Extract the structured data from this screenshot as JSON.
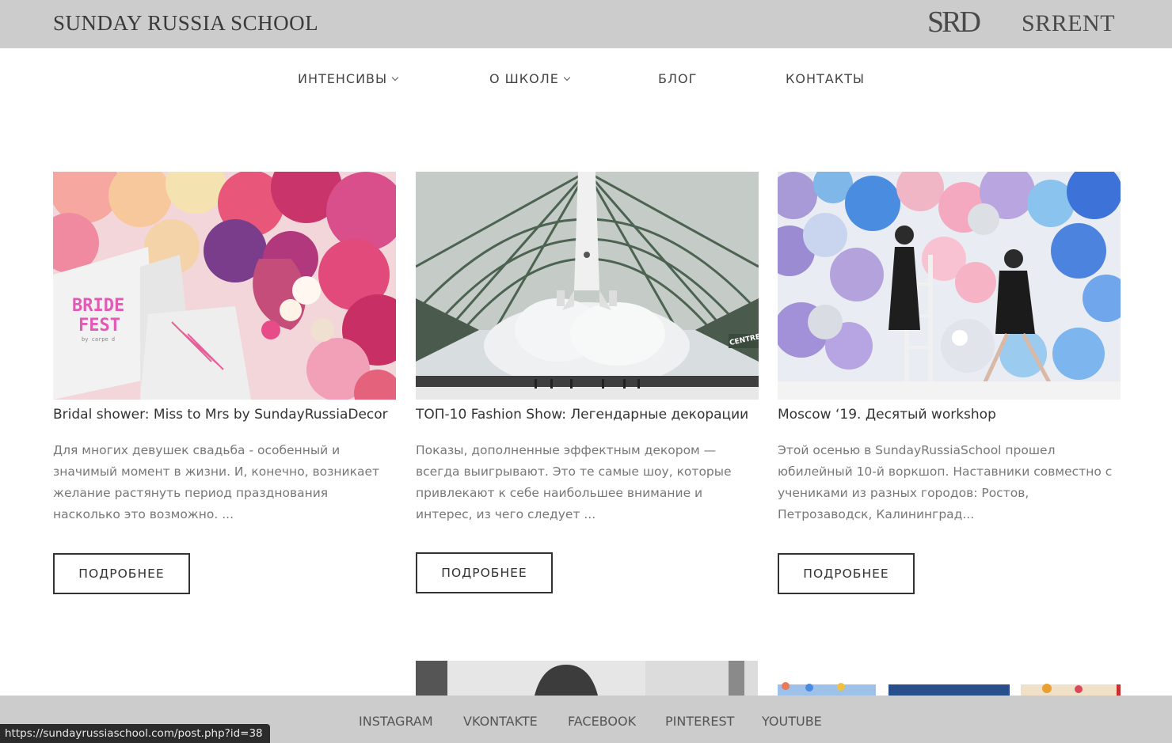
{
  "header": {
    "brand": "SUNDAY RUSSIA SCHOOL",
    "logo_srd": "SRD",
    "logo_srrent": "SRRENT"
  },
  "nav": {
    "items": [
      {
        "label": "ИНТЕНСИВЫ",
        "dropdown": true
      },
      {
        "label": "О ШКОЛЕ",
        "dropdown": true
      },
      {
        "label": "БЛОГ",
        "dropdown": false
      },
      {
        "label": "КОНТАКТЫ",
        "dropdown": false
      }
    ]
  },
  "posts": [
    {
      "title": "Bridal shower: Miss to Mrs by SundayRussiaDecor",
      "excerpt": "Для многих девушек свадьба - особенный и значимый момент в жизни. И, конечно, возникает желание растянуть период празднования насколько это возможно. ...",
      "button": "ПОДРОБНЕЕ",
      "image_text": [
        "BRIDE",
        "FEST",
        "by carpe d"
      ]
    },
    {
      "title": "ТОП-10 Fashion Show: Легендарные декорации",
      "excerpt": "Показы, дополненные эффектным декором — всегда выигрывают. Это те самые шоу, которые привлекают к себе наибольшее внимание и интерес, из чего следует ...",
      "button": "ПОДРОБНЕЕ",
      "image_text": [
        "CENTRE"
      ]
    },
    {
      "title": "Moscow ‘19. Десятый workshop",
      "excerpt": "Этой осенью в SundayRussiaSchool прошел юбилейный 10-й воркшоп. Наставники совместно с учениками из разных городов: Ростов, Петрозаводск, Калининград...",
      "button": "ПОДРОБНЕЕ"
    }
  ],
  "footer": {
    "links": [
      "INSTAGRAM",
      "VKONTAKTE",
      "FACEBOOK",
      "PINTEREST",
      "YOUTUBE"
    ]
  },
  "status_url": "https://sundayrussiaschool.com/post.php?id=38"
}
